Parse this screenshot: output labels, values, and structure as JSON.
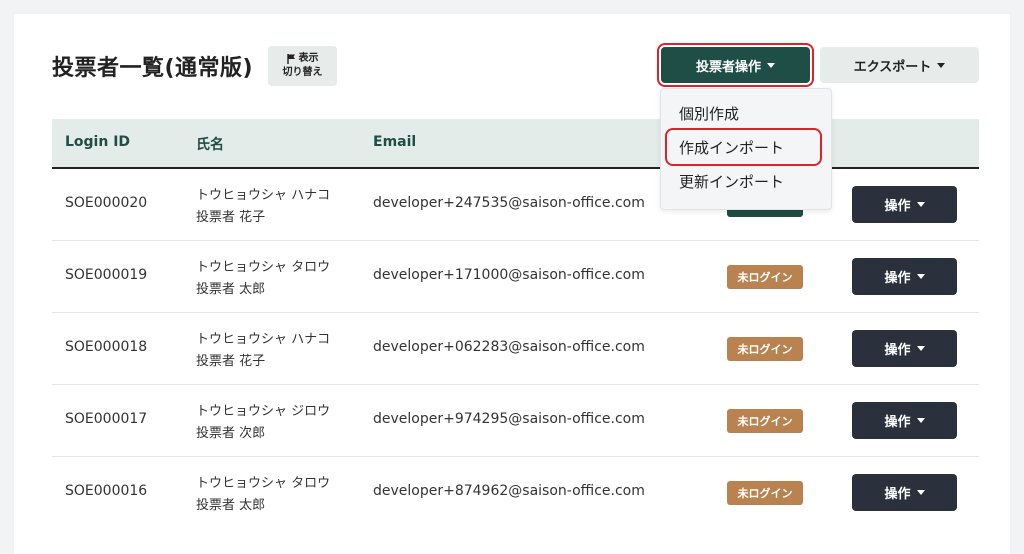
{
  "page": {
    "title": "投票者一覧(通常版)",
    "toggle": {
      "line1": "表示",
      "line2": "切り替え",
      "icon": "flag-icon"
    }
  },
  "toolbar": {
    "voter_ops_label": "投票者操作",
    "export_label": "エクスポート"
  },
  "dropdown": {
    "items": [
      "個別作成",
      "作成インポート",
      "更新インポート"
    ]
  },
  "table": {
    "headers": {
      "login_id": "Login ID",
      "name": "氏名",
      "email": "Email"
    },
    "rows": [
      {
        "login_id": "SOE000020",
        "kana": "トウヒョウシャ ハナコ",
        "name": "投票者 花子",
        "email": "developer+247535@saison-office.com",
        "status": "",
        "action": "操作"
      },
      {
        "login_id": "SOE000019",
        "kana": "トウヒョウシャ タロウ",
        "name": "投票者 太郎",
        "email": "developer+171000@saison-office.com",
        "status": "未ログイン",
        "action": "操作"
      },
      {
        "login_id": "SOE000018",
        "kana": "トウヒョウシャ ハナコ",
        "name": "投票者 花子",
        "email": "developer+062283@saison-office.com",
        "status": "未ログイン",
        "action": "操作"
      },
      {
        "login_id": "SOE000017",
        "kana": "トウヒョウシャ ジロウ",
        "name": "投票者 次郎",
        "email": "developer+974295@saison-office.com",
        "status": "未ログイン",
        "action": "操作"
      },
      {
        "login_id": "SOE000016",
        "kana": "トウヒョウシャ タロウ",
        "name": "投票者 太郎",
        "email": "developer+874962@saison-office.com",
        "status": "未ログイン",
        "action": "操作"
      }
    ]
  },
  "colors": {
    "primary": "#1e4e45",
    "header_bg": "#e4ece9",
    "status_badge": "#b9824f",
    "action_button": "#2a303c",
    "highlight": "#e0202a"
  }
}
